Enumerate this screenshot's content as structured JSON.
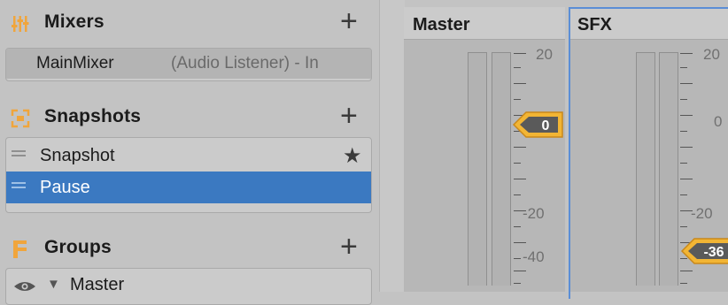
{
  "mixers": {
    "title": "Mixers",
    "add_label": "+",
    "items": [
      {
        "name": "MainMixer",
        "detail": "(Audio Listener) - In"
      }
    ]
  },
  "snapshots": {
    "title": "Snapshots",
    "add_label": "+",
    "items": [
      {
        "label": "Snapshot",
        "starred": true
      },
      {
        "label": "Pause",
        "selected": true
      }
    ]
  },
  "groups": {
    "title": "Groups",
    "add_label": "+",
    "items": [
      {
        "label": "Master"
      }
    ]
  },
  "channels": [
    {
      "name": "Master",
      "scale": [
        "20",
        "-20",
        "-40"
      ],
      "attenuation_label": "0",
      "attenuation_db": 0
    },
    {
      "name": "SFX",
      "scale": [
        "20",
        "0",
        "-20"
      ],
      "attenuation_label": "-36",
      "attenuation_db": -36
    }
  ],
  "colors": {
    "selection": "#3b79c1",
    "badge": "#f2b534",
    "focus_outline": "#5b8ed6",
    "icon_orange": "#f0a53c"
  }
}
